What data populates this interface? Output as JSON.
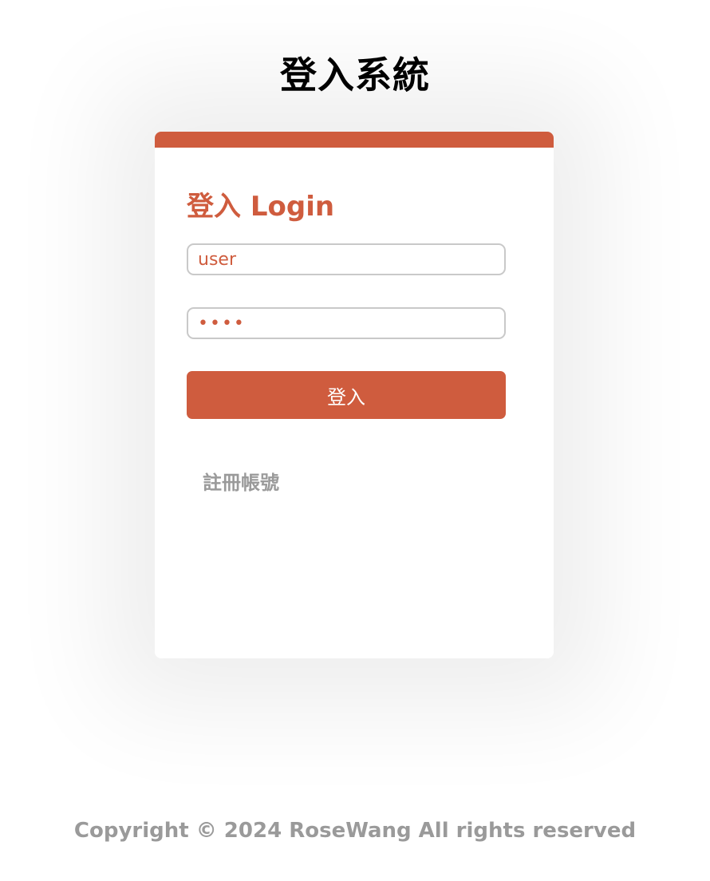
{
  "header": {
    "title": "登入系統"
  },
  "login_card": {
    "heading": "登入 Login",
    "username_value": "user",
    "password_value": "1234",
    "submit_label": "登入",
    "register_link": "註冊帳號"
  },
  "footer": {
    "copyright": "Copyright © 2024 RoseWang All rights reserved"
  },
  "colors": {
    "accent": "#cf5c3e",
    "muted_text": "#9a9a9a",
    "input_border": "#c9c9c9"
  }
}
